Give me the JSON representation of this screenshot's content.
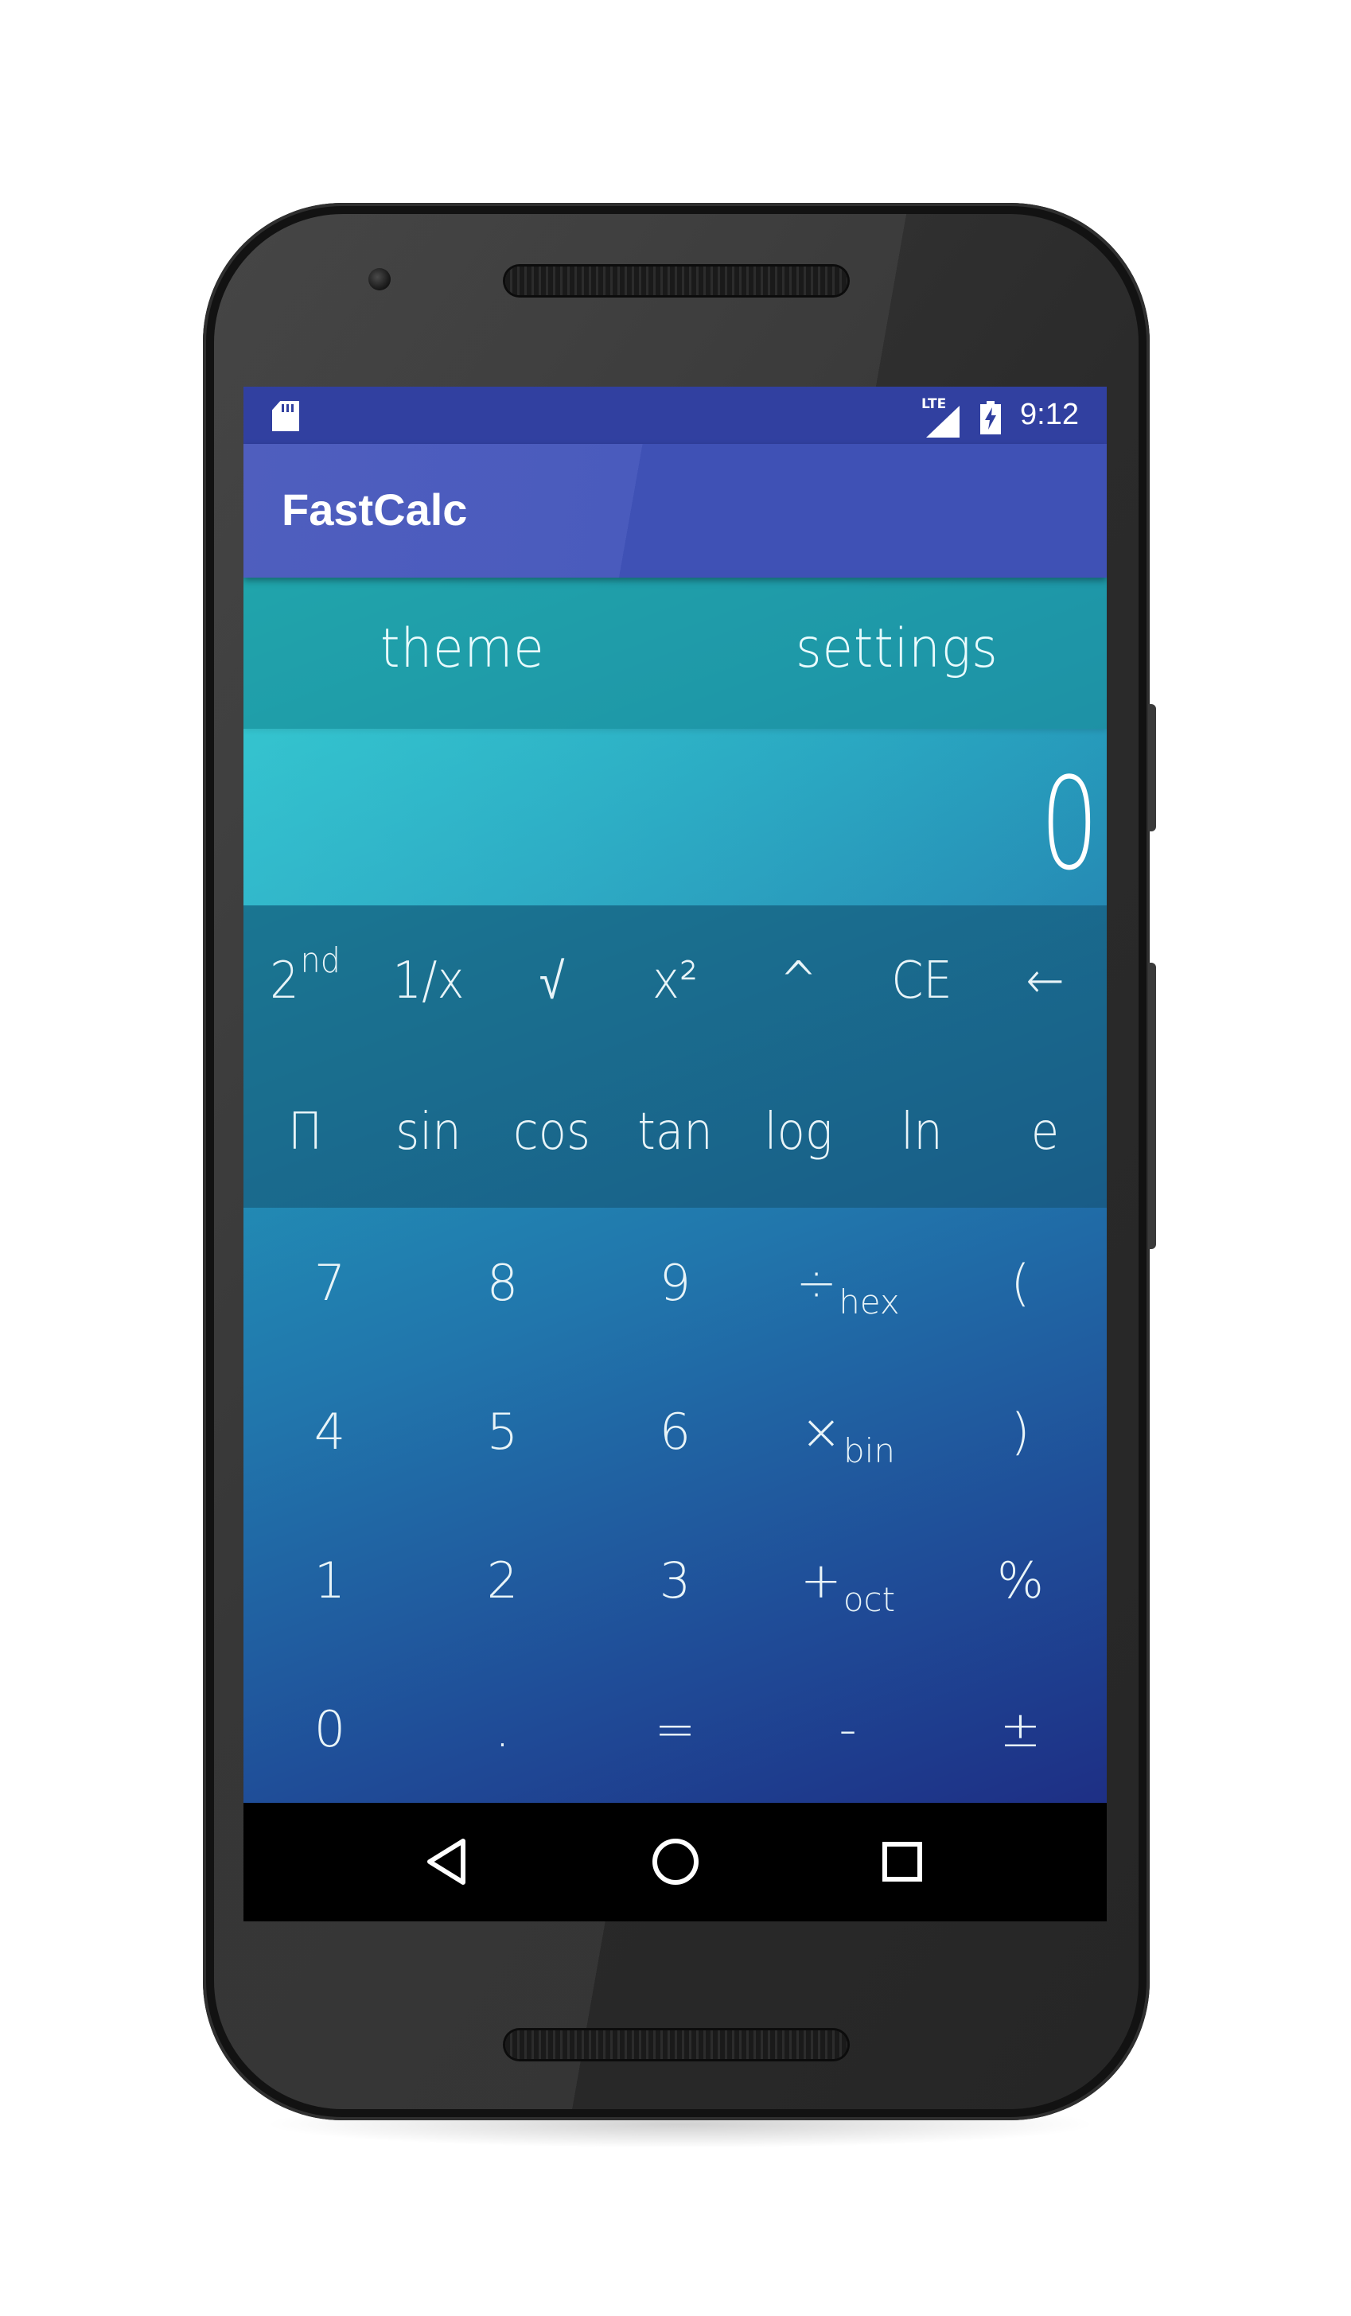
{
  "status_bar": {
    "network_label": "LTE",
    "time": "9:12",
    "icons": [
      "sd-card-icon",
      "signal-icon",
      "battery-charging-icon"
    ]
  },
  "app_bar": {
    "title": "FastCalc"
  },
  "top_menu": {
    "theme_label": "theme",
    "settings_label": "settings"
  },
  "display": {
    "value": "0"
  },
  "scientific_rows": [
    [
      {
        "name": "second-function",
        "label": "2",
        "sup": "nd"
      },
      {
        "name": "reciprocal",
        "label": "1/x"
      },
      {
        "name": "square-root",
        "label": "√"
      },
      {
        "name": "square",
        "label": "x²"
      },
      {
        "name": "power",
        "label": "^"
      },
      {
        "name": "clear-entry",
        "label": "CE"
      },
      {
        "name": "backspace",
        "label": "←"
      }
    ],
    [
      {
        "name": "pi",
        "label": "Π"
      },
      {
        "name": "sin",
        "label": "sin"
      },
      {
        "name": "cos",
        "label": "cos"
      },
      {
        "name": "tan",
        "label": "tan"
      },
      {
        "name": "log",
        "label": "log"
      },
      {
        "name": "ln",
        "label": "ln"
      },
      {
        "name": "e",
        "label": "e"
      }
    ]
  ],
  "keypad_rows": [
    [
      {
        "name": "digit-7",
        "label": "7"
      },
      {
        "name": "digit-8",
        "label": "8"
      },
      {
        "name": "digit-9",
        "label": "9"
      },
      {
        "name": "divide",
        "label": "÷",
        "sub": "hex"
      },
      {
        "name": "open-paren",
        "label": "("
      }
    ],
    [
      {
        "name": "digit-4",
        "label": "4"
      },
      {
        "name": "digit-5",
        "label": "5"
      },
      {
        "name": "digit-6",
        "label": "6"
      },
      {
        "name": "multiply",
        "label": "×",
        "sub": "bin"
      },
      {
        "name": "close-paren",
        "label": ")"
      }
    ],
    [
      {
        "name": "digit-1",
        "label": "1"
      },
      {
        "name": "digit-2",
        "label": "2"
      },
      {
        "name": "digit-3",
        "label": "3"
      },
      {
        "name": "plus",
        "label": "+",
        "sub": "oct"
      },
      {
        "name": "percent",
        "label": "%"
      }
    ],
    [
      {
        "name": "digit-0",
        "label": "0"
      },
      {
        "name": "decimal-point",
        "label": "."
      },
      {
        "name": "equals",
        "label": "="
      },
      {
        "name": "minus",
        "label": "-"
      },
      {
        "name": "plus-minus",
        "label": "±"
      }
    ]
  ],
  "nav_bar": {
    "icons": [
      "back-icon",
      "home-icon",
      "recents-icon"
    ]
  }
}
